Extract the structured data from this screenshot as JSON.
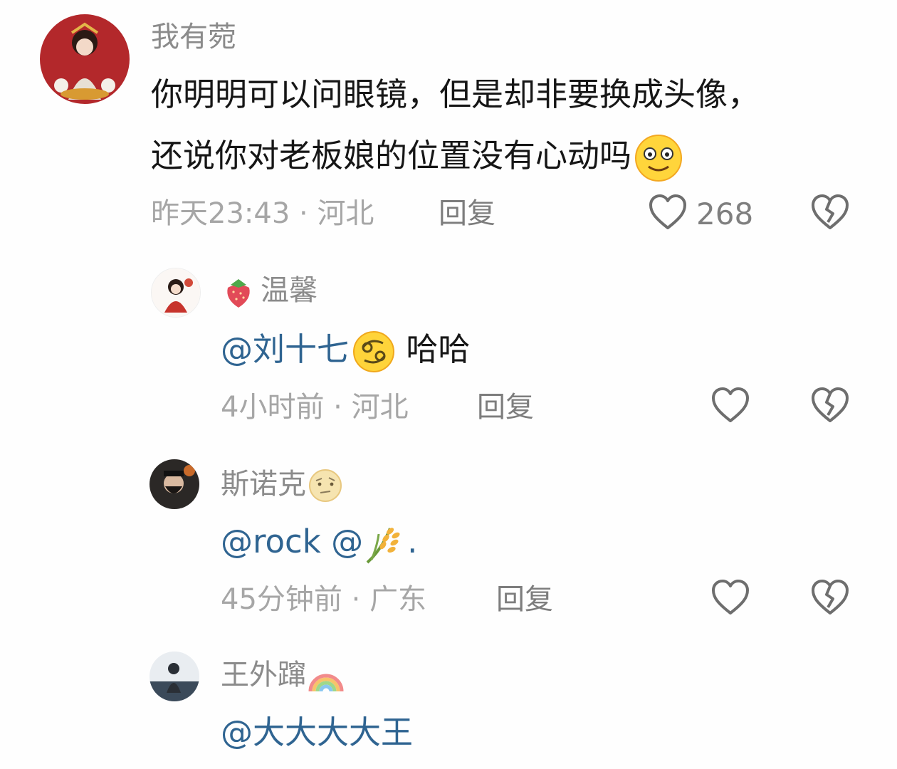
{
  "comments": [
    {
      "username": "我有菀",
      "text_lines": [
        "你明明可以问眼镜，但是却非要换成头像，",
        "还说你对老板娘的位置没有心动吗"
      ],
      "time": "昨天23:43",
      "location": "河北",
      "reply_label": "回复",
      "likes": "268"
    }
  ],
  "replies": [
    {
      "username": "温馨",
      "mention": "@刘十七",
      "text": " 哈哈",
      "time": "4小时前",
      "location": "河北",
      "reply_label": "回复"
    },
    {
      "username": "斯诺克",
      "mention": "@rock @",
      "text_after": ".",
      "time": "45分钟前",
      "location": "广东",
      "reply_label": "回复"
    },
    {
      "username": "王外蹿",
      "mention": "@大大大大王"
    }
  ],
  "separator": "·",
  "icons": {
    "heart": "heart-outline-icon",
    "dislike": "broken-heart-icon"
  },
  "colors": {
    "mention": "#2f6491",
    "username": "#8b8b8b",
    "meta": "#a6a6a6"
  }
}
